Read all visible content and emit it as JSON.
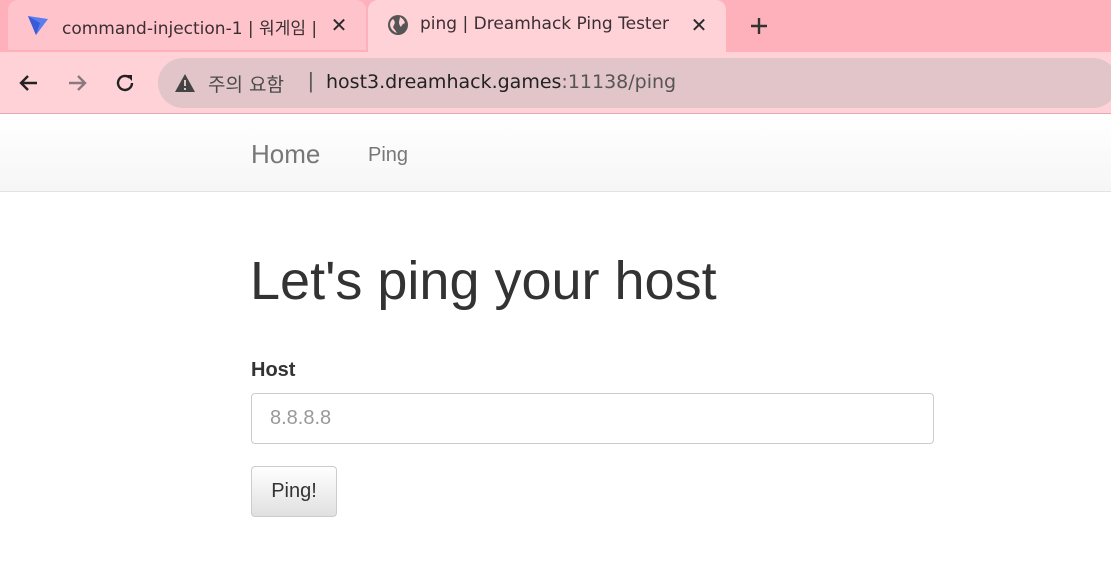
{
  "browser": {
    "tabs": [
      {
        "title": "command-injection-1 | 워게임 |",
        "favicon": "dreamhack-logo-icon",
        "active": false
      },
      {
        "title": "ping | Dreamhack Ping Tester",
        "favicon": "globe-icon",
        "active": true
      }
    ],
    "security_label": "주의 요함",
    "url_host": "host3.dreamhack.games",
    "url_rest": ":11138/ping"
  },
  "page": {
    "nav": {
      "brand": "Home",
      "links": [
        "Ping"
      ]
    },
    "heading": "Let's ping your host",
    "form": {
      "label": "Host",
      "placeholder": "8.8.8.8",
      "value": "",
      "submit": "Ping!"
    }
  },
  "colors": {
    "tabstrip": "#ffb1bb",
    "toolbar": "#ffd2d7",
    "omnibox": "#e2c5c9"
  }
}
